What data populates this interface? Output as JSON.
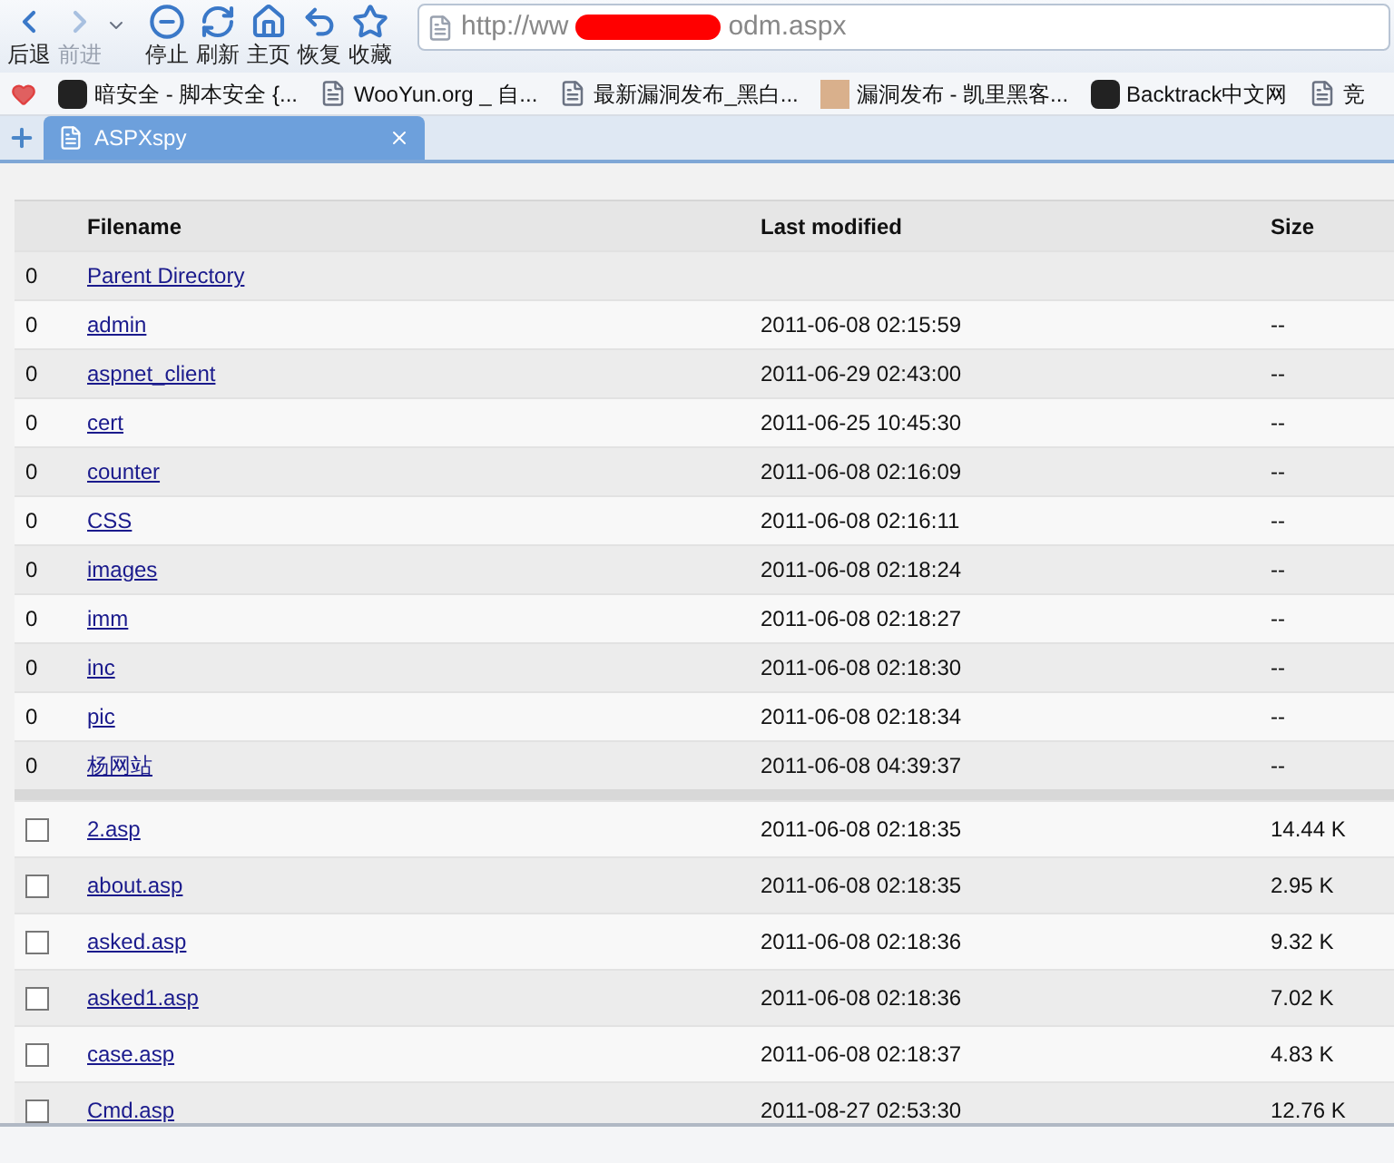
{
  "toolbar": {
    "buttons": [
      {
        "kind": "back",
        "label": "后退",
        "disabled": false
      },
      {
        "kind": "forward",
        "label": "前进",
        "disabled": true
      },
      {
        "kind": "stop",
        "label": "停止",
        "disabled": false
      },
      {
        "kind": "refresh",
        "label": "刷新",
        "disabled": false
      },
      {
        "kind": "home",
        "label": "主页",
        "disabled": false
      },
      {
        "kind": "undo",
        "label": "恢复",
        "disabled": false
      },
      {
        "kind": "star",
        "label": "收藏",
        "disabled": false
      }
    ],
    "address": {
      "start": "http://ww",
      "end": "odm.aspx"
    }
  },
  "bookmarks": [
    {
      "kind": "logo",
      "label": "暗安全 - 脚本安全 {..."
    },
    {
      "kind": "page",
      "label": "WooYun.org _ 自..."
    },
    {
      "kind": "page",
      "label": "最新漏洞发布_黑白..."
    },
    {
      "kind": "photo",
      "label": "漏洞发布 - 凯里黑客..."
    },
    {
      "kind": "logo",
      "label": "Backtrack中文网"
    },
    {
      "kind": "page",
      "label": "竞"
    }
  ],
  "tabs": [
    {
      "label": "ASPXspy",
      "selected": true
    }
  ],
  "table": {
    "columns": [
      "Filename",
      "Last modified",
      "Size"
    ],
    "rows": [
      {
        "kind": "folder",
        "index": "0",
        "name": "Parent Directory"
      },
      {
        "kind": "folder",
        "index": "0",
        "name": "admin",
        "modified": "2011-06-08 02:15:59",
        "size": "--"
      },
      {
        "kind": "folder",
        "index": "0",
        "name": "aspnet_client",
        "modified": "2011-06-29 02:43:00",
        "size": "--"
      },
      {
        "kind": "folder",
        "index": "0",
        "name": "cert",
        "modified": "2011-06-25 10:45:30",
        "size": "--"
      },
      {
        "kind": "folder",
        "index": "0",
        "name": "counter",
        "modified": "2011-06-08 02:16:09",
        "size": "--"
      },
      {
        "kind": "folder",
        "index": "0",
        "name": "CSS",
        "modified": "2011-06-08 02:16:11",
        "size": "--"
      },
      {
        "kind": "folder",
        "index": "0",
        "name": "images",
        "modified": "2011-06-08 02:18:24",
        "size": "--"
      },
      {
        "kind": "folder",
        "index": "0",
        "name": "imm",
        "modified": "2011-06-08 02:18:27",
        "size": "--"
      },
      {
        "kind": "folder",
        "index": "0",
        "name": "inc",
        "modified": "2011-06-08 02:18:30",
        "size": "--"
      },
      {
        "kind": "folder",
        "index": "0",
        "name": "pic",
        "modified": "2011-06-08 02:18:34",
        "size": "--"
      },
      {
        "kind": "folder",
        "index": "0",
        "name": "杨网站",
        "modified": "2011-06-08 04:39:37",
        "size": "--"
      },
      {
        "kind": "separator"
      },
      {
        "kind": "file",
        "checked": false,
        "name": "2.asp",
        "modified": "2011-06-08 02:18:35",
        "size": "14.44 K"
      },
      {
        "kind": "file",
        "checked": false,
        "name": "about.asp",
        "modified": "2011-06-08 02:18:35",
        "size": "2.95 K"
      },
      {
        "kind": "file",
        "checked": false,
        "name": "asked.asp",
        "modified": "2011-06-08 02:18:36",
        "size": "9.32 K"
      },
      {
        "kind": "file",
        "checked": false,
        "name": "asked1.asp",
        "modified": "2011-06-08 02:18:36",
        "size": "7.02 K"
      },
      {
        "kind": "file",
        "checked": false,
        "name": "case.asp",
        "modified": "2011-06-08 02:18:37",
        "size": "4.83 K"
      },
      {
        "kind": "file",
        "checked": false,
        "name": "Cmd.asp",
        "modified": "2011-08-27 02:53:30",
        "size": "12.76 K"
      }
    ]
  }
}
